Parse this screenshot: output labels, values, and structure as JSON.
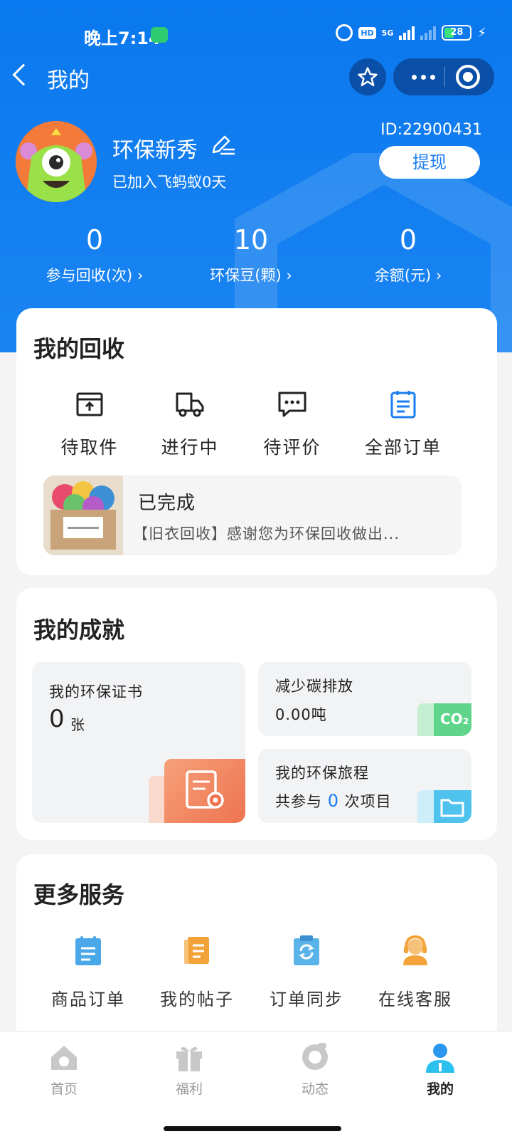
{
  "status_bar": {
    "time": "晚上7:14",
    "hd": "HD",
    "network": "5G",
    "battery": "28"
  },
  "nav": {
    "title": "我的",
    "icons": [
      "back-icon",
      "star-icon",
      "more-icon",
      "target-icon"
    ]
  },
  "profile": {
    "name": "环保新秀",
    "joined": "已加入飞蚂蚁0天",
    "id": "ID:22900431",
    "withdraw_label": "提现"
  },
  "stats": [
    {
      "value": "0",
      "label": "参与回收(次)"
    },
    {
      "value": "10",
      "label": "环保豆(颗)"
    },
    {
      "value": "0",
      "label": "余额(元)"
    }
  ],
  "recycle": {
    "title": "我的回收",
    "items": [
      {
        "label": "待取件",
        "icon": "package-icon"
      },
      {
        "label": "进行中",
        "icon": "truck-icon"
      },
      {
        "label": "待评价",
        "icon": "comment-icon"
      },
      {
        "label": "全部订单",
        "icon": "clipboard-icon"
      }
    ],
    "latest": {
      "status": "已完成",
      "desc": "【旧衣回收】感谢您为环保回收做出..."
    }
  },
  "achievements": {
    "title": "我的成就",
    "certificate": {
      "title": "我的环保证书",
      "count": "0",
      "unit": "张"
    },
    "carbon": {
      "title": "减少碳排放",
      "value": "0.00吨",
      "badge": "CO₂"
    },
    "journey": {
      "title": "我的环保旅程",
      "prefix": "共参与",
      "count": "0",
      "suffix": "次项目"
    }
  },
  "services": {
    "title": "更多服务",
    "items": [
      {
        "label": "商品订单",
        "icon": "order-icon"
      },
      {
        "label": "我的帖子",
        "icon": "post-icon"
      },
      {
        "label": "订单同步",
        "icon": "sync-icon"
      },
      {
        "label": "在线客服",
        "icon": "support-icon"
      }
    ]
  },
  "tabbar": [
    {
      "label": "首页",
      "icon": "home-icon"
    },
    {
      "label": "福利",
      "icon": "gift-icon"
    },
    {
      "label": "动态",
      "icon": "feed-icon"
    },
    {
      "label": "我的",
      "icon": "profile-icon",
      "active": true
    }
  ],
  "colors": {
    "primary": "#1a84f2",
    "accent_orange": "#f1865c",
    "accent_green": "#5ed58b",
    "accent_cyan": "#4fc3ee"
  }
}
